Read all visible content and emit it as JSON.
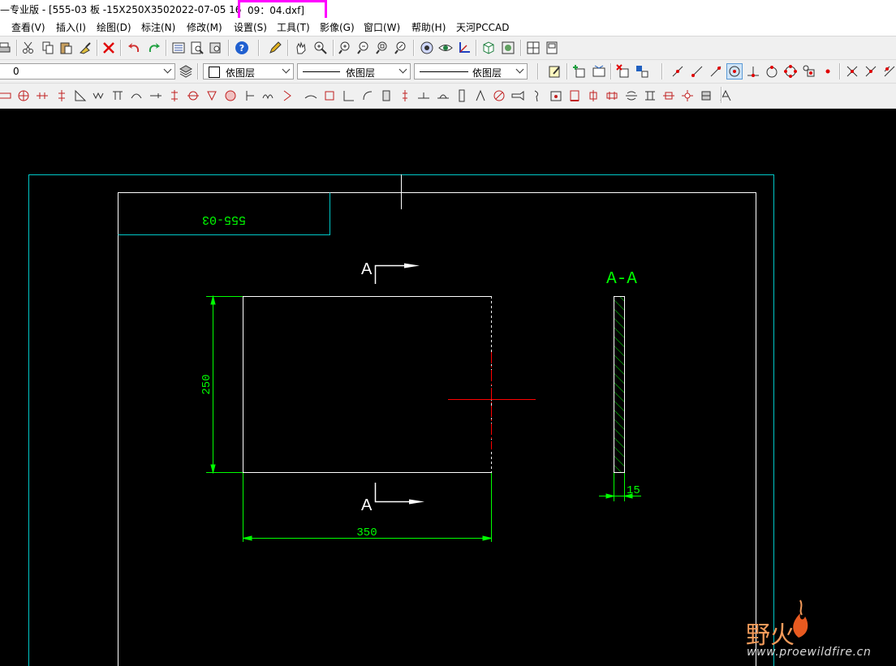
{
  "window": {
    "title_prefix": "—专业版 - [555-03 板 -15X250X3502022-07-05 16",
    "title_highlight": "09：04.dxf]"
  },
  "menu": [
    "查看(V)",
    "插入(I)",
    "绘图(D)",
    "标注(N)",
    "修改(M)",
    "设置(S)",
    "工具(T)",
    "影像(G)",
    "窗口(W)",
    "帮助(H)",
    "天河PCCAD"
  ],
  "properties": {
    "layer_value": "0",
    "color_value": "依图层",
    "linetype_value": "依图层",
    "lineweight_value": "依图层"
  },
  "drawing": {
    "part_label": "555-03",
    "section_marker": "A",
    "section_view_label": "A-A",
    "dim_height": "250",
    "dim_width": "350",
    "dim_thickness": "15",
    "colors": {
      "background": "#000000",
      "frame": "#00c8c8",
      "geometry": "#ffffff",
      "dimension": "#00ff00",
      "centerline": "#ff0000",
      "hatch": "#00c800"
    }
  },
  "watermark": {
    "brand_cn": "野火",
    "url": "www.proewildfire.cn"
  }
}
